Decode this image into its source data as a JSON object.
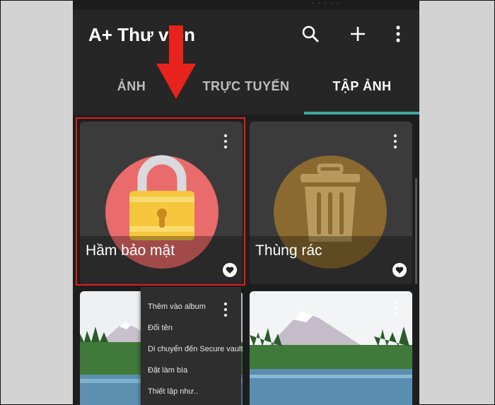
{
  "app": {
    "title": "A+ Thư viện"
  },
  "tabs": [
    {
      "label": "ẢNH"
    },
    {
      "label": "TRỰC TUYẾN"
    },
    {
      "label": "TẬP ẢNH"
    }
  ],
  "albums": [
    {
      "title": "Hầm bảo mật"
    },
    {
      "title": "Thùng rác"
    }
  ],
  "context_menu": {
    "items": [
      {
        "label": "Thêm vào album"
      },
      {
        "label": "Đổi tên"
      },
      {
        "label": "Di chuyển đến Secure vault"
      },
      {
        "label": "Đặt làm bìa"
      },
      {
        "label": "Thiết lập như.."
      }
    ]
  },
  "colors": {
    "accent_tab_indicator": "#3fa9a0",
    "vault_circle": "#e96b6b",
    "trash_circle": "#8a6a30",
    "highlight_border": "#e02020",
    "arrow": "#e8221c"
  }
}
